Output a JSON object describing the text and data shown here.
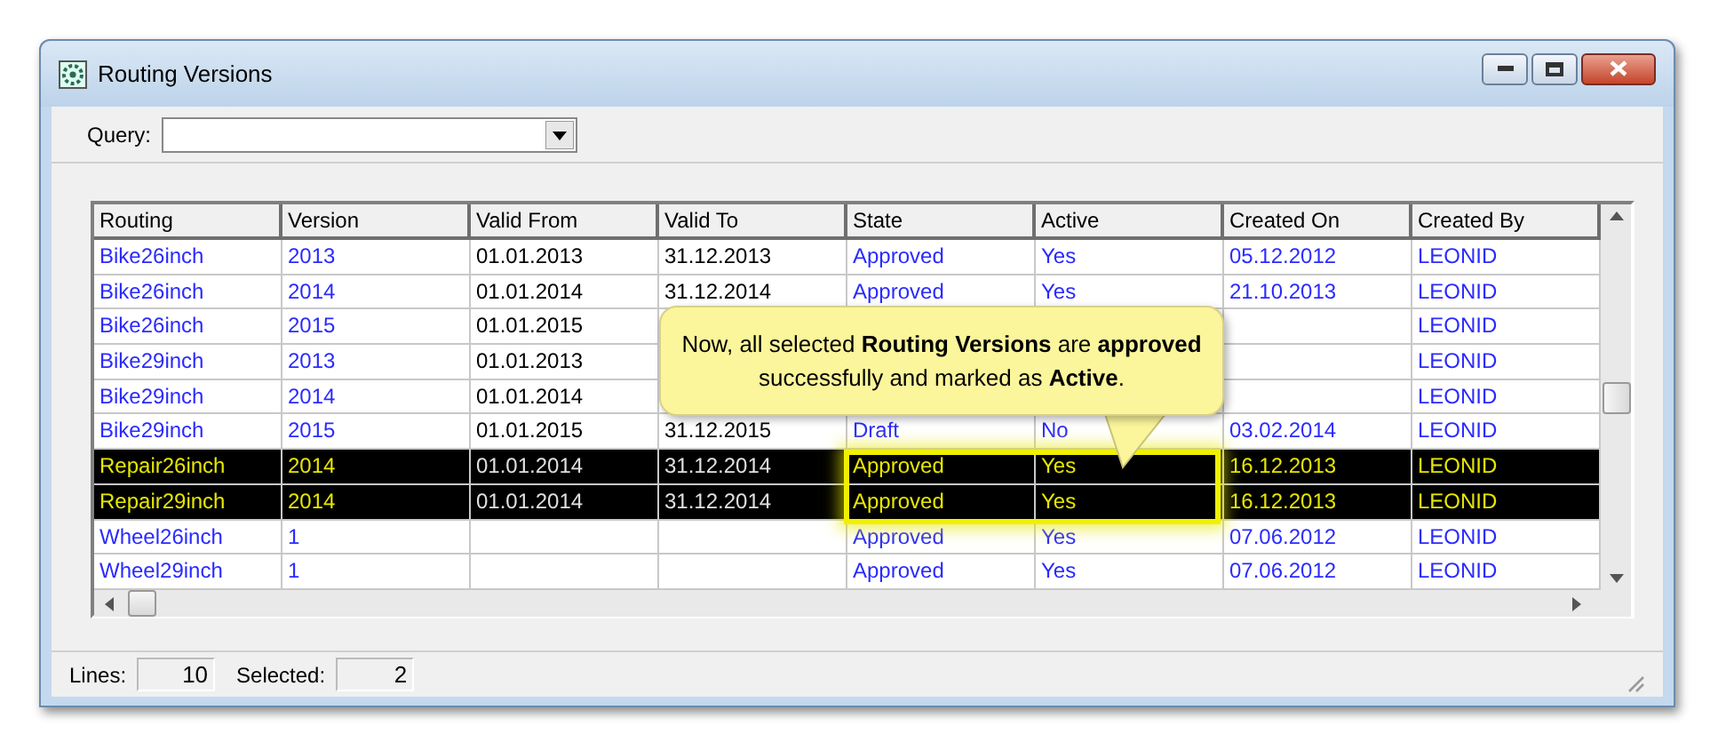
{
  "window": {
    "title": "Routing Versions"
  },
  "query": {
    "label": "Query:"
  },
  "table": {
    "columns": [
      {
        "label": "Routing",
        "kind": "link"
      },
      {
        "label": "Version",
        "kind": "link"
      },
      {
        "label": "Valid From",
        "kind": "plain"
      },
      {
        "label": "Valid To",
        "kind": "plain"
      },
      {
        "label": "State",
        "kind": "link"
      },
      {
        "label": "Active",
        "kind": "link"
      },
      {
        "label": "Created On",
        "kind": "link"
      },
      {
        "label": "Created By",
        "kind": "link"
      }
    ],
    "rows": [
      {
        "selected": false,
        "routing": "Bike26inch",
        "version": "2013",
        "valid_from": "01.01.2013",
        "valid_to": "31.12.2013",
        "state": "Approved",
        "active": "Yes",
        "created_on": "05.12.2012",
        "created_by": "LEONID"
      },
      {
        "selected": false,
        "routing": "Bike26inch",
        "version": "2014",
        "valid_from": "01.01.2014",
        "valid_to": "31.12.2014",
        "state": "Approved",
        "active": "Yes",
        "created_on": "21.10.2013",
        "created_by": "LEONID"
      },
      {
        "selected": false,
        "routing": "Bike26inch",
        "version": "2015",
        "valid_from": "01.01.2015",
        "created_by": "LEONID"
      },
      {
        "selected": false,
        "routing": "Bike29inch",
        "version": "2013",
        "valid_from": "01.01.2013",
        "created_by": "LEONID"
      },
      {
        "selected": false,
        "routing": "Bike29inch",
        "version": "2014",
        "valid_from": "01.01.2014",
        "created_by": "LEONID"
      },
      {
        "selected": false,
        "routing": "Bike29inch",
        "version": "2015",
        "valid_from": "01.01.2015",
        "valid_to": "31.12.2015",
        "state": "Draft",
        "active": "No",
        "created_on": "03.02.2014",
        "created_by": "LEONID"
      },
      {
        "selected": true,
        "routing": "Repair26inch",
        "version": "2014",
        "valid_from": "01.01.2014",
        "valid_to": "31.12.2014",
        "state": "Approved",
        "active": "Yes",
        "created_on": "16.12.2013",
        "created_by": "LEONID"
      },
      {
        "selected": true,
        "routing": "Repair29inch",
        "version": "2014",
        "valid_from": "01.01.2014",
        "valid_to": "31.12.2014",
        "state": "Approved",
        "active": "Yes",
        "created_on": "16.12.2013",
        "created_by": "LEONID"
      },
      {
        "selected": false,
        "routing": "Wheel26inch",
        "version": "1",
        "state": "Approved",
        "active": "Yes",
        "created_on": "07.06.2012",
        "created_by": "LEONID"
      },
      {
        "selected": false,
        "routing": "Wheel29inch",
        "version": "1",
        "state": "Approved",
        "active": "Yes",
        "created_on": "07.06.2012",
        "created_by": "LEONID"
      }
    ]
  },
  "callout": {
    "text": "Now, all selected **Routing Versions** are **approved** successfully and marked as **Active**."
  },
  "status_bar": {
    "lines_label": "Lines:",
    "lines": "10",
    "selected_label": "Selected:",
    "selected": "2"
  }
}
